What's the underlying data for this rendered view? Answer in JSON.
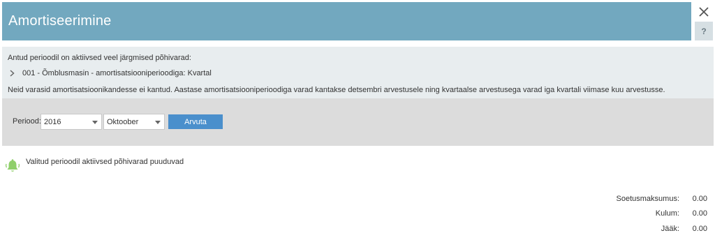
{
  "header": {
    "title": "Amortiseerimine",
    "help_label": "?"
  },
  "info": {
    "line1": "Antud perioodil on aktiivsed veel järgmised põhivarad:",
    "asset": "001 - Õmblusmasin - amortisatsiooniperioodiga: Kvartal",
    "line3": "Neid varasid amortisatsioonikandesse ei kantud. Aastase amortisatsiooniperioodiga varad kantakse detsembri arvestusele ning kvartaalse arvestusega varad iga kvartali viimase kuu arvestusse."
  },
  "filter": {
    "period_label": "Periood:",
    "year": "2016",
    "month": "Oktoober",
    "calc_button": "Arvuta"
  },
  "notice": {
    "text": "Valitud perioodil aktiivsed põhivarad puuduvad",
    "icon": "bell-icon"
  },
  "totals": [
    {
      "label": "Soetusmaksumus:",
      "value": "0.00"
    },
    {
      "label": "Kulum:",
      "value": "0.00"
    },
    {
      "label": "Jääk:",
      "value": "0.00"
    }
  ],
  "colors": {
    "header": "#72a8bf",
    "button": "#4a8fcc",
    "bell": "#8fcf6a"
  }
}
